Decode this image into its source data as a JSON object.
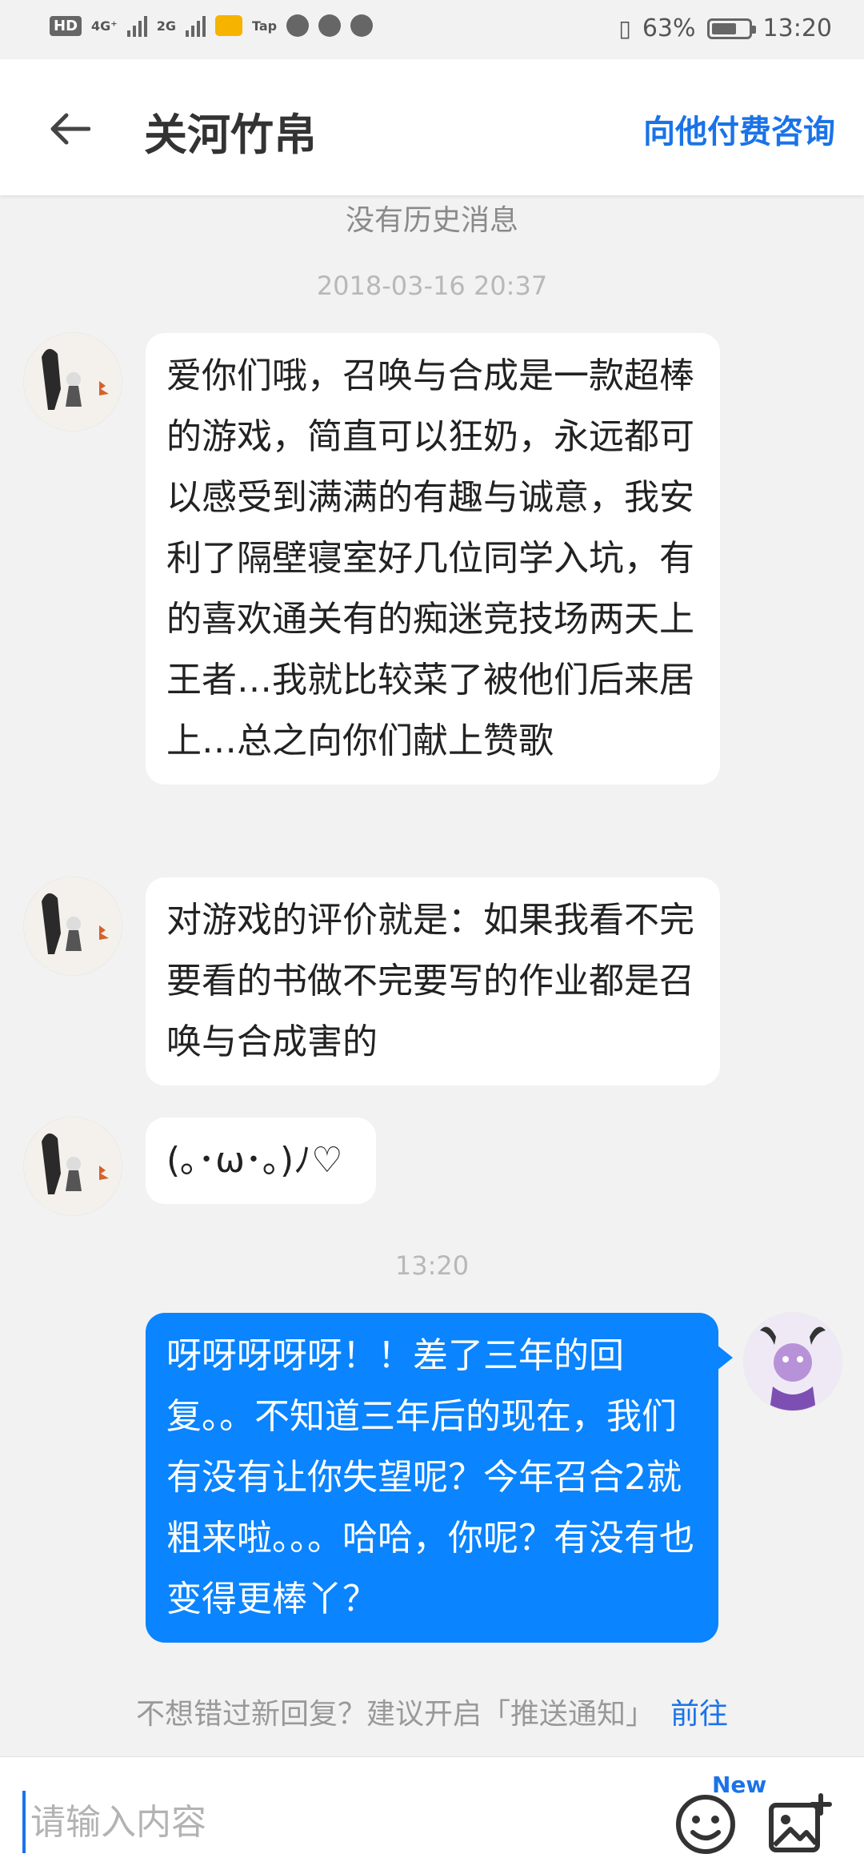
{
  "status_bar": {
    "left_chips": [
      "HD",
      "4G⁺",
      "2G",
      "Tap"
    ],
    "battery": "63%",
    "time": "13:20"
  },
  "header": {
    "title": "关河竹帛",
    "consult_label": "向他付费咨询"
  },
  "chat": {
    "no_history": "没有历史消息",
    "timestamp_1": "2018-03-16 20:37",
    "messages_other": [
      "爱你们哦，召唤与合成是一款超棒的游戏，简直可以狂奶，永远都可以感受到满满的有趣与诚意，我安利了隔壁寝室好几位同学入坑，有的喜欢通关有的痴迷竞技场两天上王者…我就比较菜了被他们后来居上…总之向你们献上赞歌",
      "对游戏的评价就是：如果我看不完要看的书做不完要写的作业都是召唤与合成害的",
      "(｡･ω･｡)ﾉ♡"
    ],
    "timestamp_2": "13:20",
    "message_me": "呀呀呀呀呀！！差了三年的回复。。不知道三年后的现在，我们有没有让你失望呢？今年召合2就粗来啦。。。哈哈，你呢？有没有也变得更棒丫？"
  },
  "push_notice": {
    "text": "不想错过新回复？建议开启「推送通知」",
    "action": "前往"
  },
  "input_bar": {
    "placeholder": "请输入内容",
    "badge": "New"
  },
  "colors": {
    "accent": "#1a73e8",
    "my_bubble": "#0a84ff",
    "background": "#f2f2f2"
  },
  "icons": [
    "back-arrow-icon",
    "emoji-icon",
    "image-add-icon",
    "battery-icon",
    "signal-icon"
  ]
}
